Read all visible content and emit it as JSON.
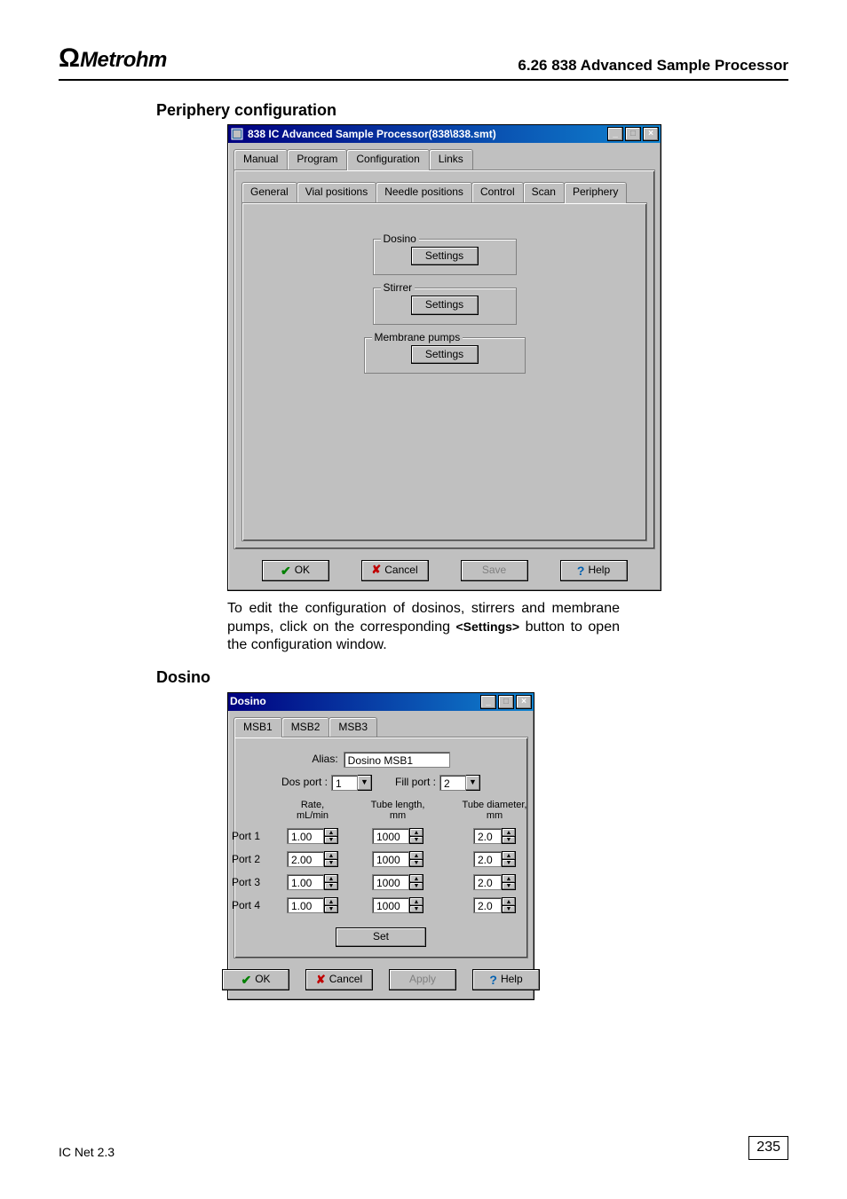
{
  "header": {
    "brand_symbol": "Ω",
    "brand_text": "Metrohm",
    "chapter": "6.26  838 Advanced Sample Processor"
  },
  "section_periphery_heading": "Periphery configuration",
  "periphery_window": {
    "title": "838 IC Advanced Sample Processor(838\\838.smt)",
    "outer_tabs": [
      "Manual",
      "Program",
      "Configuration",
      "Links"
    ],
    "outer_active": "Configuration",
    "inner_tabs": [
      "General",
      "Vial positions",
      "Needle positions",
      "Control",
      "Scan",
      "Periphery"
    ],
    "inner_active": "Periphery",
    "groups": {
      "dosino": {
        "legend": "Dosino",
        "button": "Settings"
      },
      "stirrer": {
        "legend": "Stirrer",
        "button": "Settings"
      },
      "membrane": {
        "legend": "Membrane pumps",
        "button": "Settings"
      }
    },
    "buttons": {
      "ok": "OK",
      "cancel": "Cancel",
      "save": "Save",
      "help": "Help"
    }
  },
  "periphery_paragraph_1": "To edit the configuration of dosinos, stirrers and membrane pumps, click on the corresponding ",
  "periphery_paragraph_bold": "<Settings>",
  "periphery_paragraph_2": " button to open the configuration window.",
  "section_dosino_heading": "Dosino",
  "dosino_window": {
    "title": "Dosino",
    "tabs": [
      "MSB1",
      "MSB2",
      "MSB3"
    ],
    "active_tab": "MSB1",
    "alias_label": "Alias:",
    "alias_value": "Dosino MSB1",
    "dosport_label": "Dos port :",
    "dosport_value": "1",
    "fillport_label": "Fill port :",
    "fillport_value": "2",
    "col_headers": {
      "rate": "Rate,\nmL/min",
      "tubelen": "Tube length,\nmm",
      "tubedia": "Tube diameter,\nmm"
    },
    "ports": [
      {
        "name": "Port 1",
        "rate": "1.00",
        "tubelen": "1000",
        "tubedia": "2.0"
      },
      {
        "name": "Port 2",
        "rate": "2.00",
        "tubelen": "1000",
        "tubedia": "2.0"
      },
      {
        "name": "Port 3",
        "rate": "1.00",
        "tubelen": "1000",
        "tubedia": "2.0"
      },
      {
        "name": "Port 4",
        "rate": "1.00",
        "tubelen": "1000",
        "tubedia": "2.0"
      }
    ],
    "set_button": "Set",
    "buttons": {
      "ok": "OK",
      "cancel": "Cancel",
      "apply": "Apply",
      "help": "Help"
    }
  },
  "footer": {
    "product": "IC Net 2.3",
    "page": "235"
  }
}
